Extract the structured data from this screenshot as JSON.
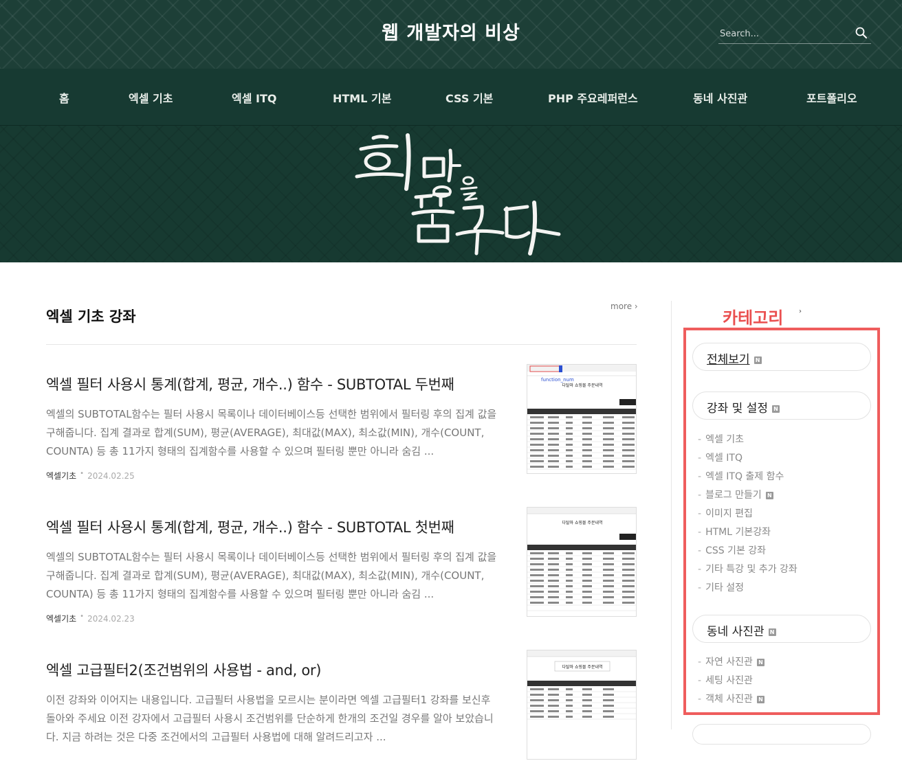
{
  "header": {
    "site_title": "웹 개발자의 비상",
    "search_placeholder": "Search..."
  },
  "nav": {
    "items": [
      "홈",
      "엑셀 기초",
      "엑셀 ITQ",
      "HTML 기본",
      "CSS 기본",
      "PHP 주요레퍼런스",
      "동네 사진관",
      "포트폴리오"
    ]
  },
  "main": {
    "section_title": "엑셀 기초 강좌",
    "more_label": "more ›",
    "posts": [
      {
        "title": "엑셀 필터 사용시 통계(합계, 평균, 개수..) 함수 - SUBTOTAL 두번째",
        "excerpt": "엑셀의 SUBTOTAL함수는 필터 사용시 목록이나 데이터베이스등 선택한 범위에서 필터링 후의 집계 값을 구해줍니다. 집계 결과로 합계(SUM), 평균(AVERAGE), 최대값(MAX), 최소값(MIN), 개수(COUNT, COUNTA) 등 총 11가지 형태의 집계함수를 사용할 수 있으며 필터링 뿐만 아니라 숨김 ...",
        "category": "엑셀기초",
        "date": "2024.02.25"
      },
      {
        "title": "엑셀 필터 사용시 통계(합계, 평균, 개수..) 함수 - SUBTOTAL 첫번째",
        "excerpt": "엑셀의 SUBTOTAL함수는 필터 사용시 목록이나 데이터베이스등 선택한 범위에서 필터링 후의 집계 값을 구해줍니다. 집계 결과로 합계(SUM), 평균(AVERAGE), 최대값(MAX), 최소값(MIN), 개수(COUNT, COUNTA) 등 총 11가지 형태의 집계함수를 사용할 수 있으며 필터링 뿐만 아니라 숨김 ...",
        "category": "엑셀기초",
        "date": "2024.02.23"
      },
      {
        "title": "엑셀 고급필터2(조건범위의 사용법 - and, or)",
        "excerpt": "이전 강좌와 이어지는 내용입니다. 고급필터 사용법을 모르시는 분이라면 엑셀 고급필터1 강좌를 보신후 돌아와 주세요 이전 강자에서 고급필터 사용시 조건범위를 단순하게 한개의 조건일 경우를 알아 보았습니다. 지금 하려는 것은 다중 조건에서의 고급필터 사용법에 대해 알려드리고자 ...",
        "category": "엑셀기초",
        "date": ""
      }
    ],
    "thumb_texts": [
      "다탈마 쇼핑몰 주문내역",
      "다탈마 쇼핑몰 주문내역",
      "다탈마 쇼핑몰 주문내역"
    ],
    "thumb_formula": "function_num"
  },
  "sidebar": {
    "heading": "카테고리",
    "heading_mark": "›",
    "badge": "N",
    "all_label": "전체보기",
    "group1": {
      "label": "강좌 및 설정",
      "items": [
        {
          "label": "엑셀 기초",
          "badge": false
        },
        {
          "label": "엑셀 ITQ",
          "badge": false
        },
        {
          "label": "엑셀 ITQ 출제 함수",
          "badge": false
        },
        {
          "label": "블로그 만들기",
          "badge": true
        },
        {
          "label": "이미지 편집",
          "badge": false
        },
        {
          "label": "HTML 기본강좌",
          "badge": false
        },
        {
          "label": "CSS 기본 강좌",
          "badge": false
        },
        {
          "label": "기타 특강 및 추가 강좌",
          "badge": false
        },
        {
          "label": "기타 설정",
          "badge": false
        }
      ]
    },
    "group2": {
      "label": "동네 사진관",
      "items": [
        {
          "label": "자연 사진관",
          "badge": true
        },
        {
          "label": "세팅 사진관",
          "badge": false
        },
        {
          "label": "객체 사진관",
          "badge": true
        }
      ]
    }
  },
  "colors": {
    "header_bg": "#1d3f37",
    "nav_bg": "#173a32",
    "accent_red": "#ef5d5d"
  }
}
